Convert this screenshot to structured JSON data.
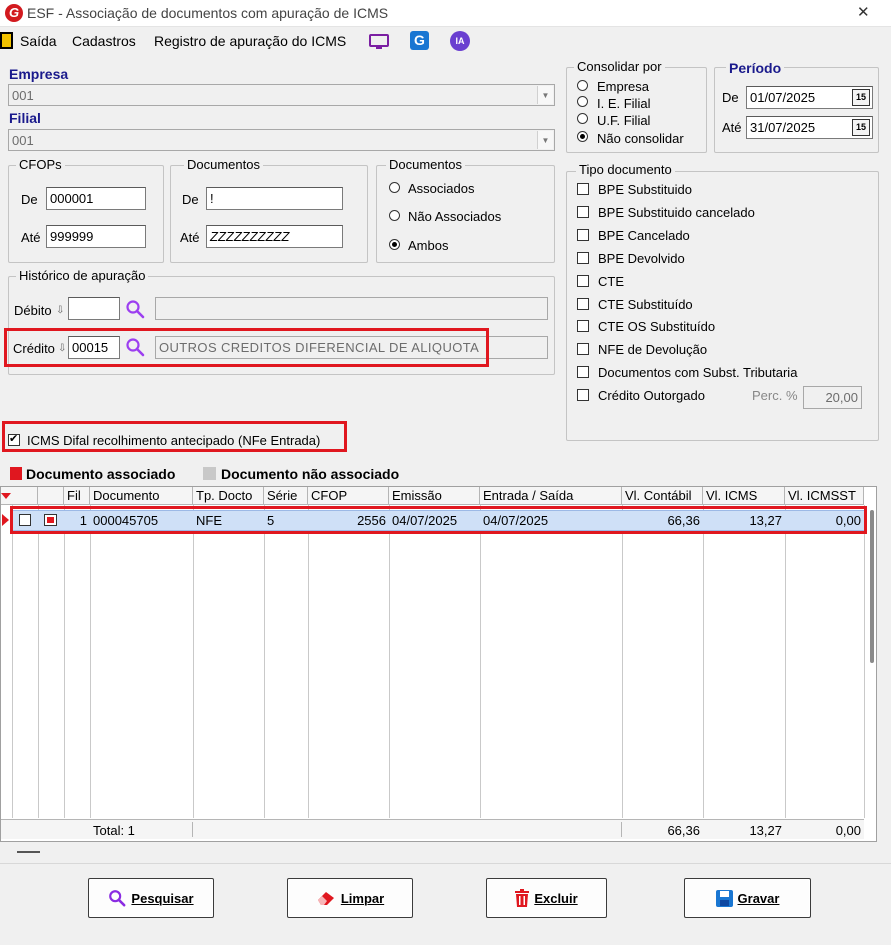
{
  "window": {
    "title": "ESF - Associação de documentos com apuração de ICMS",
    "close_glyph": "✕"
  },
  "menu": {
    "items": [
      "Saída",
      "Cadastros",
      "Registro de apuração do ICMS"
    ],
    "ia_label": "IA"
  },
  "empresa": {
    "label": "Empresa",
    "value": "001"
  },
  "filial": {
    "label": "Filial",
    "value": "001"
  },
  "consolidar": {
    "title": "Consolidar por",
    "options": [
      "Empresa",
      "I. E. Filial",
      "U.F. Filial",
      "Não consolidar"
    ],
    "selected": 3
  },
  "periodo": {
    "title": "Período",
    "de_label": "De",
    "de_value": "01/07/2025",
    "ate_label": "Até",
    "ate_value": "31/07/2025",
    "cal_glyph": "15"
  },
  "cfops": {
    "title": "CFOPs",
    "de_label": "De",
    "de_value": "000001",
    "ate_label": "Até",
    "ate_value": "999999"
  },
  "documentos": {
    "title": "Documentos",
    "de_label": "De",
    "de_value": "!",
    "ate_label": "Até",
    "ate_value": "ZZZZZZZZZZ"
  },
  "docs_radio": {
    "title": "Documentos",
    "options": [
      "Associados",
      "Não Associados",
      "Ambos"
    ],
    "selected": 2
  },
  "historico": {
    "title": "Histórico de apuração",
    "debito_label": "Débito",
    "debito_value": "",
    "debito_desc": "",
    "credito_label": "Crédito",
    "credito_value": "00015",
    "credito_desc": "OUTROS CREDITOS DIFERENCIAL DE ALIQUOTA"
  },
  "tipo_documento": {
    "title": "Tipo documento",
    "items": [
      "BPE Substituido",
      "BPE Substituido cancelado",
      "BPE Cancelado",
      "BPE Devolvido",
      "CTE",
      "CTE Substituído",
      "CTE OS Substituído",
      "NFE de Devolução",
      "Documentos com Subst. Tributaria",
      "Crédito Outorgado"
    ],
    "perc_label": "Perc. %",
    "perc_value": "20,00"
  },
  "icms_difal": {
    "label": "ICMS Difal recolhimento antecipado (NFe Entrada)",
    "checked": true
  },
  "legend": {
    "associado": "Documento associado",
    "nao_associado": "Documento não associado"
  },
  "grid": {
    "columns": [
      "Fil",
      "Documento",
      "Tp. Docto",
      "Série",
      "CFOP",
      "Emissão",
      "Entrada / Saída",
      "Vl. Contábil",
      "Vl. ICMS",
      "Vl. ICMSST"
    ],
    "rows": [
      {
        "fil": "1",
        "documento": "000045705",
        "tp_docto": "NFE",
        "serie": "5",
        "cfop": "2556",
        "emissao": "04/07/2025",
        "entrada_saida": "04/07/2025",
        "vl_contabil": "66,36",
        "vl_icms": "13,27",
        "vl_icmsst": "0,00"
      }
    ],
    "footer": {
      "total": "Total: 1",
      "vl_contabil": "66,36",
      "vl_icms": "13,27",
      "vl_icmsst": "0,00"
    }
  },
  "buttons": {
    "pesquisar": "Pesquisar",
    "limpar": "Limpar",
    "excluir": "Excluir",
    "gravar": "Gravar"
  },
  "colors": {
    "accent_blue": "#1a1a8c",
    "highlight_red": "#e0171f",
    "row_selected": "#cfe0f7"
  }
}
